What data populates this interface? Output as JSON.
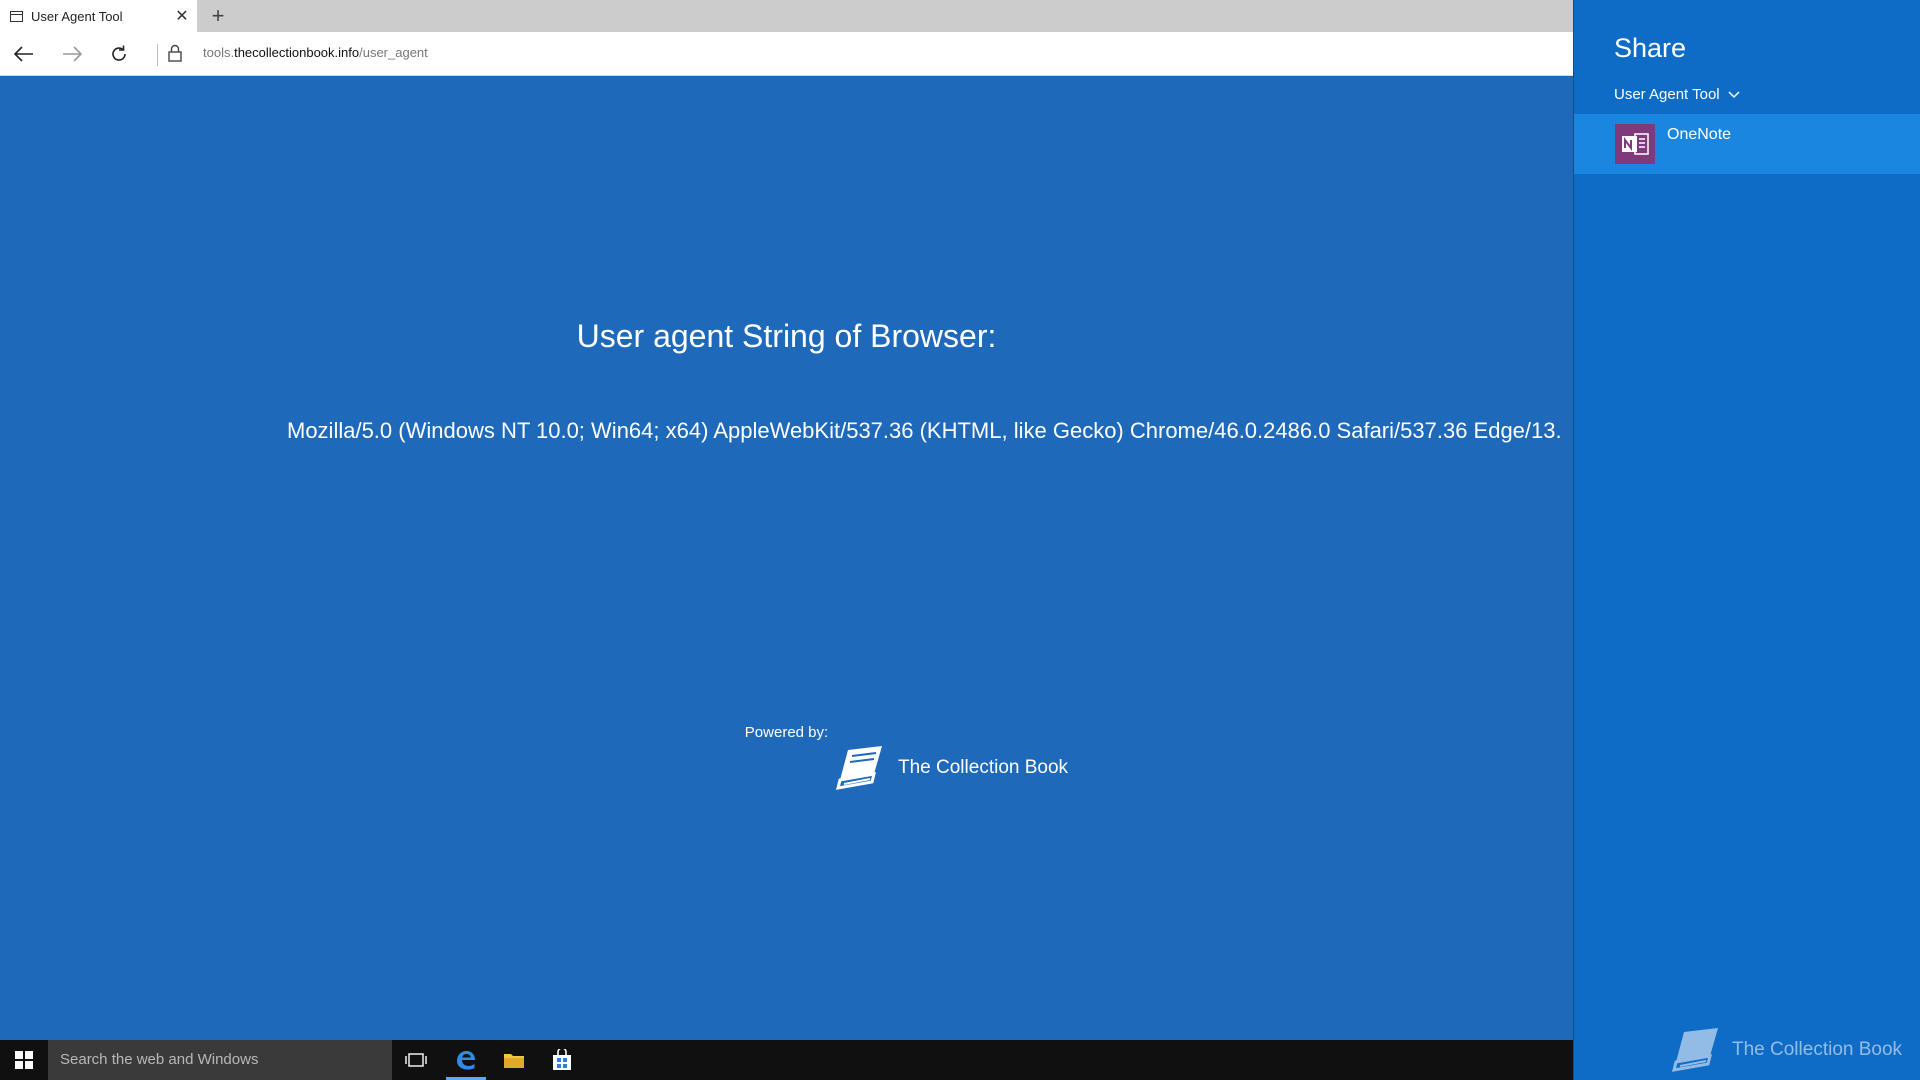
{
  "browser": {
    "tab": {
      "title": "User Agent Tool",
      "close": "✕"
    },
    "new_tab": "+",
    "address": {
      "host": "tools.thecollectionbook.info",
      "path": "/user_agent",
      "prefix": "tools.",
      "domain": "thecollectionbook.info"
    }
  },
  "page": {
    "heading": "User agent String of Browser:",
    "user_agent": "Mozilla/5.0 (Windows NT 10.0; Win64; x64) AppleWebKit/537.36 (KHTML, like Gecko) Chrome/46.0.2486.0 Safari/537.36 Edge/13.",
    "powered_by": "Powered by:",
    "brand": "The Collection Book"
  },
  "share": {
    "title": "Share",
    "source": "User Agent Tool",
    "targets": [
      {
        "label": "OneNote"
      }
    ],
    "footer_brand": "The Collection Book"
  },
  "taskbar": {
    "search_placeholder": "Search the web and Windows"
  },
  "colors": {
    "page_bg": "#1e69b9",
    "share_bg": "#0e6cc7",
    "share_selected": "#1a86e0",
    "onenote": "#80397b",
    "taskbar": "#101010"
  }
}
